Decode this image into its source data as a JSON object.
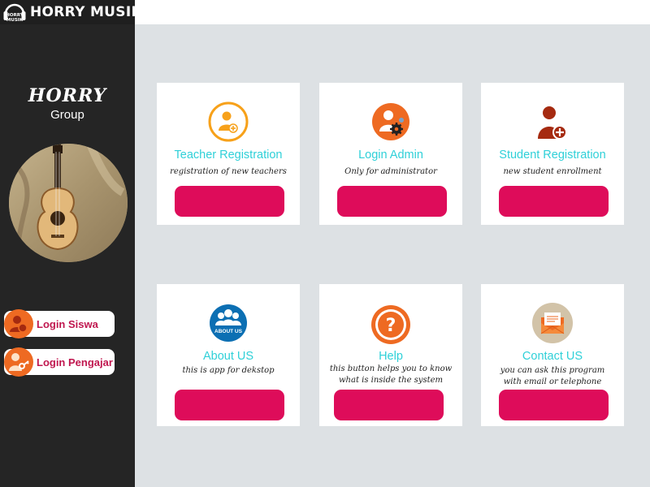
{
  "brand": {
    "logo_text_top": "HORRY",
    "logo_text_bottom": "MUSIK",
    "name": "HORRY MUSIK"
  },
  "sidebar": {
    "title": "HORRY",
    "subtitle": "Group",
    "buttons": [
      {
        "label": "Login Siswa"
      },
      {
        "label": "Login Pengajar"
      }
    ]
  },
  "cards": [
    {
      "title": "Teacher Registration",
      "desc": "registration of new teachers",
      "icon": "teacher-add-icon"
    },
    {
      "title": "Login Admin",
      "desc": "Only for administrator",
      "icon": "admin-gear-icon"
    },
    {
      "title": "Student Registration",
      "desc": "new student enrollment",
      "icon": "student-add-icon"
    },
    {
      "title": "About US",
      "desc": "this is app for dekstop",
      "icon": "about-us-icon",
      "icon_text": "ABOUT US"
    },
    {
      "title": "Help",
      "desc_line1": "this button helps you to know",
      "desc_line2": "what is inside the system",
      "icon": "help-icon"
    },
    {
      "title": "Contact US",
      "desc_line1": "you can ask this program",
      "desc_line2": "with email or telephone",
      "icon": "mail-icon"
    }
  ],
  "colors": {
    "accent_button": "#de0c5a",
    "title_cyan": "#2fd0d8",
    "orange": "#ee6a22",
    "sidebar": "#252525",
    "background": "#dde1e4"
  }
}
